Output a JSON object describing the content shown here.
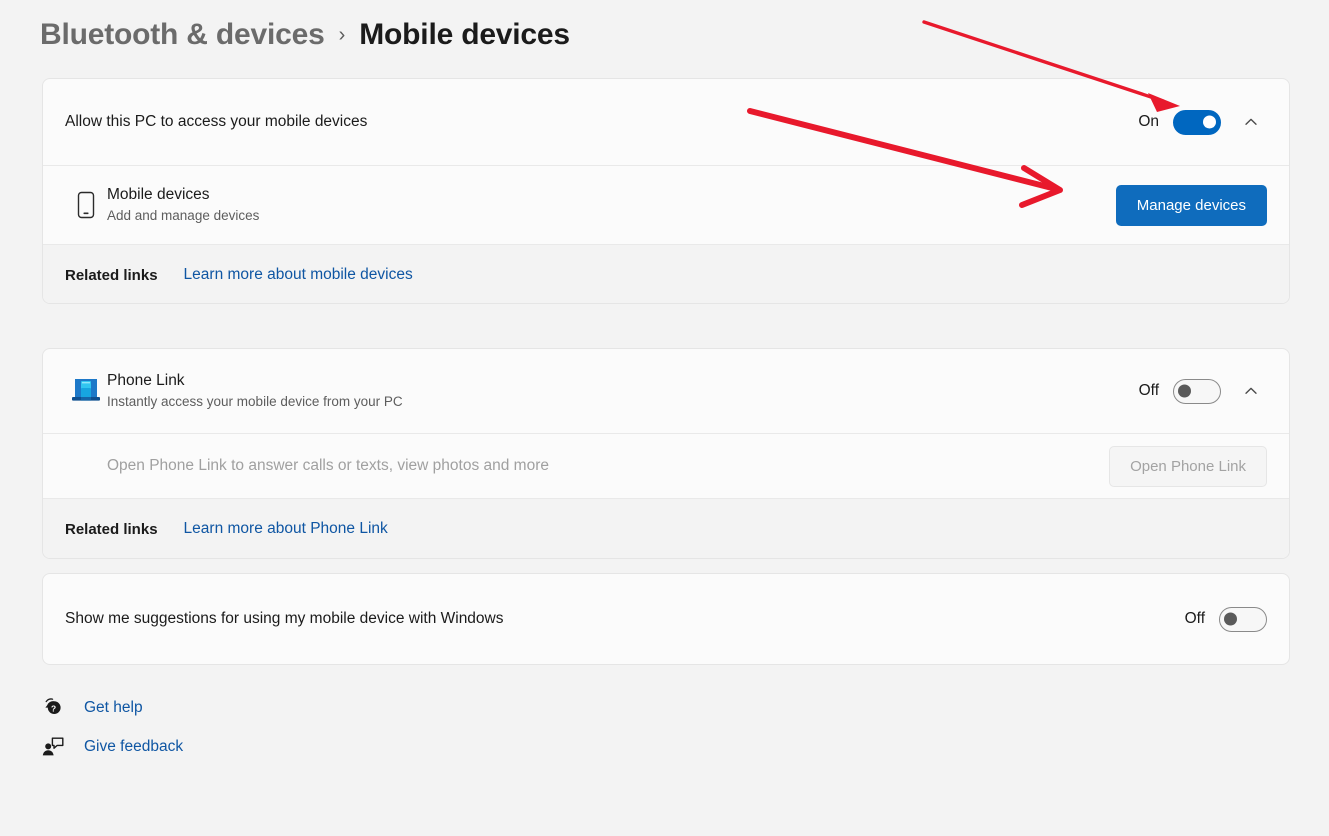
{
  "breadcrumb": {
    "parent": "Bluetooth & devices",
    "separator": "›",
    "current": "Mobile devices"
  },
  "colors": {
    "accent": "#0f6cbd",
    "toggle_on": "#0067c0",
    "link": "#0f56a3",
    "annotation_red": "#e8192c",
    "page_background": "#f3f3f3",
    "card_background": "#fbfbfb"
  },
  "mobile_devices_card": {
    "header": {
      "label": "Allow this PC to access your mobile devices",
      "toggle_state": "On",
      "toggle_value": "on",
      "expand_icon": "chevron-up-icon"
    },
    "device_row": {
      "icon": "phone-icon",
      "title": "Mobile devices",
      "subtitle": "Add and manage devices",
      "button_label": "Manage devices"
    },
    "related": {
      "label": "Related links",
      "link_label": "Learn more about mobile devices"
    }
  },
  "phone_link_card": {
    "header": {
      "icon": "phone-link-app-icon",
      "title": "Phone Link",
      "subtitle": "Instantly access your mobile device from your PC",
      "toggle_state": "Off",
      "toggle_value": "off",
      "expand_icon": "chevron-up-icon"
    },
    "open_row": {
      "label": "Open Phone Link to answer calls or texts, view photos and more",
      "button_label": "Open Phone Link",
      "button_disabled": true
    },
    "related": {
      "label": "Related links",
      "link_label": "Learn more about Phone Link"
    }
  },
  "suggestions_card": {
    "label": "Show me suggestions for using my mobile device with Windows",
    "toggle_state": "Off",
    "toggle_value": "off"
  },
  "footer": {
    "items": [
      {
        "icon": "get-help-icon",
        "label": "Get help"
      },
      {
        "icon": "give-feedback-icon",
        "label": "Give feedback"
      }
    ]
  },
  "annotations": [
    {
      "name": "arrow-to-toggle",
      "color": "#e8192c"
    },
    {
      "name": "arrow-to-manage-devices-button",
      "color": "#e8192c"
    }
  ]
}
